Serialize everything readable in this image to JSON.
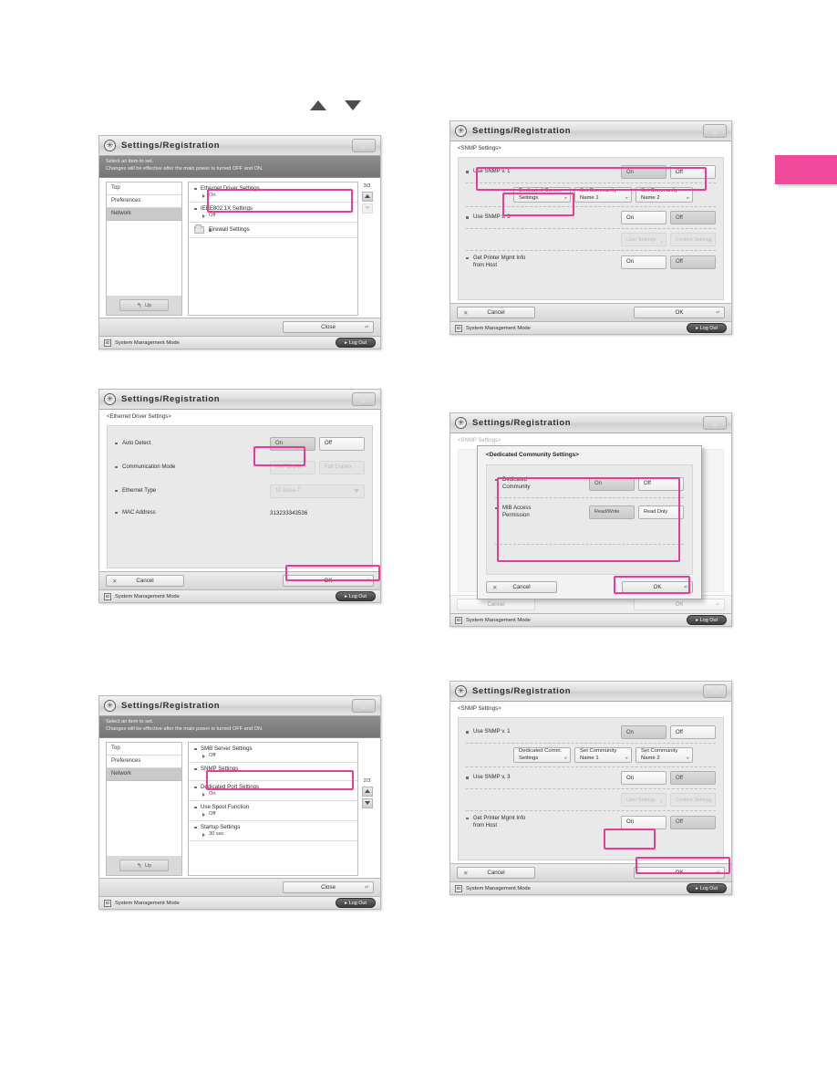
{
  "page": {
    "edge_tab_color": "#ef4a9b",
    "highlight_color": "#ea3c96"
  },
  "arrow_glyphs": {
    "up": "triangle-up",
    "down": "triangle-down"
  },
  "common": {
    "app_title": "Settings/Registration",
    "logo_icon": "canon-asterisk-icon",
    "titlebar_button_icon": "help-icon",
    "status_text": "System Management Mode",
    "status_icon": "ID",
    "logout_label": "Log Out",
    "logout_icon": "logout-arrow-icon",
    "close_label": "Close",
    "cancel_label": "Cancel",
    "ok_label": "OK",
    "return_glyph": "↵",
    "cancel_glyph": "✕",
    "up_label": "Up",
    "up_icon": "up-level-icon",
    "on_label": "On",
    "off_label": "Off"
  },
  "panel1": {
    "instruction_line1": "Select an item to set.",
    "instruction_line2": "Changes will be effective after the main power is turned OFF and ON.",
    "nav_items": [
      {
        "label": "Top",
        "selected": false
      },
      {
        "label": "Preferences",
        "selected": false
      },
      {
        "label": "Network",
        "selected": true
      }
    ],
    "list_items": [
      {
        "title": "Ethernet Driver Settings",
        "value": "On",
        "type": "setting",
        "highlighted": true
      },
      {
        "title": "IEEE802.1X Settings",
        "value": "Off",
        "type": "setting"
      },
      {
        "title": "Firewall Settings",
        "value": "",
        "type": "folder"
      }
    ],
    "page_indicator": "3/3",
    "scroll_up_enabled": true,
    "scroll_down_enabled": false
  },
  "panel2": {
    "subtitle": "<Ethernet Driver Settings>",
    "rows": [
      {
        "label": "Auto Detect",
        "type": "toggle",
        "options": [
          "On",
          "Off"
        ],
        "selected": "On",
        "disabled": false,
        "highlighted": true
      },
      {
        "label": "Communication Mode",
        "type": "toggle",
        "options": [
          "Half Duplex",
          "Full Duplex"
        ],
        "selected": "",
        "disabled": true
      },
      {
        "label": "Ethernet Type",
        "type": "dropdown",
        "value": "10 Base-T",
        "disabled": true
      },
      {
        "label": "MAC Address",
        "type": "text",
        "value": "313233343536"
      }
    ],
    "ok_highlighted": true
  },
  "panel3": {
    "instruction_line1": "Select an item to set.",
    "instruction_line2": "Changes will be effective after the main power is turned OFF and ON.",
    "nav_items": [
      {
        "label": "Top",
        "selected": false
      },
      {
        "label": "Preferences",
        "selected": false
      },
      {
        "label": "Network",
        "selected": true
      }
    ],
    "list_items": [
      {
        "title": "SMB Server Settings",
        "value": "Off",
        "type": "setting"
      },
      {
        "title": "SNMP Settings",
        "value": "",
        "type": "setting",
        "highlighted": true
      },
      {
        "title": "Dedicated Port Settings",
        "value": "On",
        "type": "setting"
      },
      {
        "title": "Use Spool Function",
        "value": "Off",
        "type": "setting"
      },
      {
        "title": "Startup Settings",
        "value": "30 sec",
        "type": "setting"
      }
    ],
    "page_indicator": "2/3",
    "scroll_up_enabled": true,
    "scroll_down_enabled": true
  },
  "panel4": {
    "subtitle": "<SNMP Settings>",
    "row_snmp1_label": "Use SNMP v. 1",
    "row_snmp1_on": "On",
    "row_snmp1_off": "Off",
    "row_snmp1_selected": "On",
    "btn_dedicated_line1": "Dedicated Comm.",
    "btn_dedicated_line2": "Settings",
    "btn_community1_line1": "Set Community",
    "btn_community1_line2": "Name 1",
    "btn_community2_line1": "Set Community",
    "btn_community2_line2": "Name 2",
    "row_snmp3_label": "Use SNMP v. 3",
    "row_snmp3_on": "On",
    "row_snmp3_off": "Off",
    "row_snmp3_selected": "Off",
    "btn_user_settings": "User Settings",
    "btn_context_settings": "Context Settings",
    "row_printer_label_line1": "Get Printer Mgmt Info",
    "row_printer_label_line2": "from Host",
    "row_printer_on": "On",
    "row_printer_off": "Off",
    "row_printer_selected": "Off",
    "highlight_snmp1_row": true,
    "highlight_dedicated_button": true
  },
  "panel5": {
    "subtitle": "<SNMP Settings>",
    "dialog_title": "<Dedicated Community Settings>",
    "rows": [
      {
        "label_line1": "Dedicated",
        "label_line2": "Community",
        "options": [
          "On",
          "Off"
        ],
        "selected": "On"
      },
      {
        "label_line1": "MIB Access",
        "label_line2": "Permission",
        "options": [
          "Read/Write",
          "Read Only"
        ],
        "selected": "Read/Write"
      }
    ],
    "highlight_rows": true,
    "ok_highlighted": true
  },
  "panel6": {
    "subtitle": "<SNMP Settings>",
    "row_snmp1_label": "Use SNMP v. 1",
    "row_snmp1_on": "On",
    "row_snmp1_off": "Off",
    "row_snmp1_selected": "On",
    "btn_dedicated_line1": "Dedicated Comm.",
    "btn_dedicated_line2": "Settings",
    "btn_community1_line1": "Set Community",
    "btn_community1_line2": "Name 1",
    "btn_community2_line1": "Set Community",
    "btn_community2_line2": "Name 2",
    "row_snmp3_label": "Use SNMP v. 3",
    "row_snmp3_on": "On",
    "row_snmp3_off": "Off",
    "row_snmp3_selected": "Off",
    "btn_user_settings": "User Settings",
    "btn_context_settings": "Context Settings",
    "row_printer_label_line1": "Get Printer Mgmt Info",
    "row_printer_label_line2": "from Host",
    "row_printer_on": "On",
    "row_printer_off": "Off",
    "row_printer_selected": "Off",
    "highlight_printer_on": true,
    "ok_highlighted": true
  }
}
